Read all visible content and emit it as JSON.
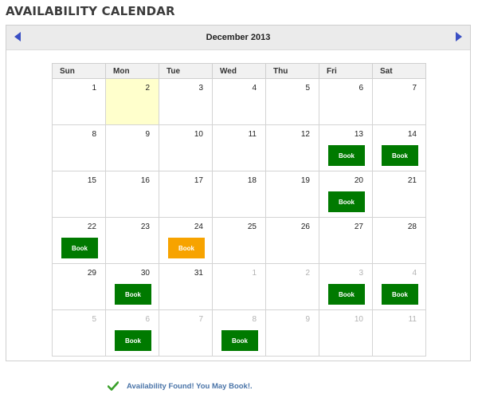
{
  "page_title": "AVAILABILITY CALENDAR",
  "calendar": {
    "month_label": "December 2013",
    "weekdays": [
      "Sun",
      "Mon",
      "Tue",
      "Wed",
      "Thu",
      "Fri",
      "Sat"
    ],
    "weeks": [
      [
        {
          "day": "1",
          "other": false
        },
        {
          "day": "2",
          "other": false,
          "today": true
        },
        {
          "day": "3",
          "other": false
        },
        {
          "day": "4",
          "other": false
        },
        {
          "day": "5",
          "other": false
        },
        {
          "day": "6",
          "other": false
        },
        {
          "day": "7",
          "other": false
        }
      ],
      [
        {
          "day": "8",
          "other": false
        },
        {
          "day": "9",
          "other": false
        },
        {
          "day": "10",
          "other": false
        },
        {
          "day": "11",
          "other": false
        },
        {
          "day": "12",
          "other": false
        },
        {
          "day": "13",
          "other": false,
          "book": "Book"
        },
        {
          "day": "14",
          "other": false,
          "book": "Book"
        }
      ],
      [
        {
          "day": "15",
          "other": false
        },
        {
          "day": "16",
          "other": false
        },
        {
          "day": "17",
          "other": false
        },
        {
          "day": "18",
          "other": false
        },
        {
          "day": "19",
          "other": false
        },
        {
          "day": "20",
          "other": false,
          "book": "Book"
        },
        {
          "day": "21",
          "other": false
        }
      ],
      [
        {
          "day": "22",
          "other": false,
          "book": "Book"
        },
        {
          "day": "23",
          "other": false
        },
        {
          "day": "24",
          "other": false,
          "book": "Book",
          "pending": true
        },
        {
          "day": "25",
          "other": false
        },
        {
          "day": "26",
          "other": false
        },
        {
          "day": "27",
          "other": false
        },
        {
          "day": "28",
          "other": false
        }
      ],
      [
        {
          "day": "29",
          "other": false
        },
        {
          "day": "30",
          "other": false,
          "book": "Book"
        },
        {
          "day": "31",
          "other": false
        },
        {
          "day": "1",
          "other": true
        },
        {
          "day": "2",
          "other": true
        },
        {
          "day": "3",
          "other": true,
          "book": "Book"
        },
        {
          "day": "4",
          "other": true,
          "book": "Book"
        }
      ],
      [
        {
          "day": "5",
          "other": true
        },
        {
          "day": "6",
          "other": true,
          "book": "Book"
        },
        {
          "day": "7",
          "other": true
        },
        {
          "day": "8",
          "other": true,
          "book": "Book"
        },
        {
          "day": "9",
          "other": true
        },
        {
          "day": "10",
          "other": true
        },
        {
          "day": "11",
          "other": true
        }
      ]
    ]
  },
  "status_message": "Availability Found! You May Book!.",
  "colors": {
    "book_available": "#007a00",
    "book_pending": "#f7a300",
    "today_highlight": "#ffffcc",
    "nav_arrow": "#3a4fc4",
    "status_text": "#4a74a8",
    "check_icon": "#3aa02a"
  },
  "icons": {
    "prev": "triangle-left-icon",
    "next": "triangle-right-icon",
    "status": "check-icon"
  }
}
